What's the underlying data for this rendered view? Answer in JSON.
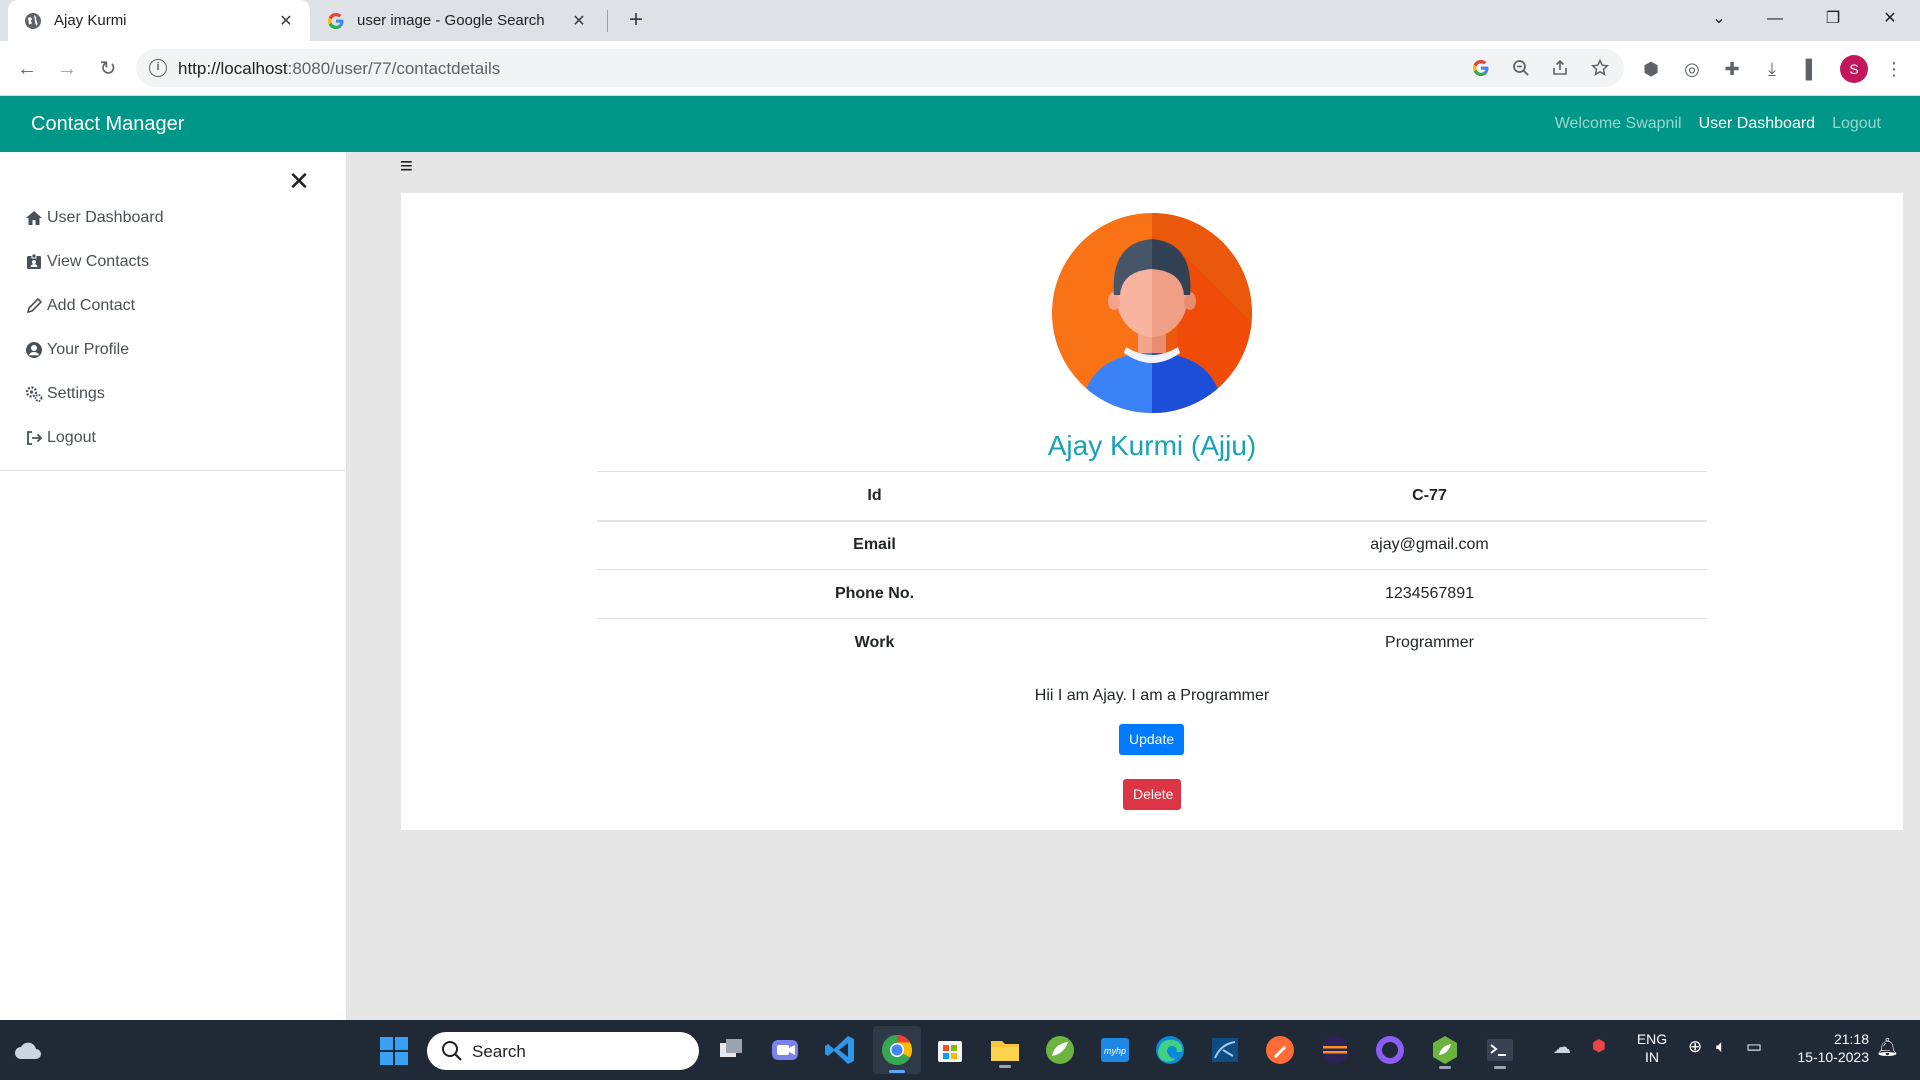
{
  "browser": {
    "tabs": [
      {
        "title": "Ajay Kurmi",
        "active": true
      },
      {
        "title": "user image - Google Search",
        "active": false
      }
    ],
    "url_host": "http://localhost",
    "url_rest": ":8080/user/77/contactdetails",
    "profile_initial": "S"
  },
  "navbar": {
    "brand": "Contact Manager",
    "welcome": "Welcome Swapnil",
    "dashboard": "User Dashboard",
    "logout": "Logout"
  },
  "sidebar": {
    "items": [
      {
        "label": "User Dashboard",
        "icon": "home-icon"
      },
      {
        "label": "View Contacts",
        "icon": "id-card-icon"
      },
      {
        "label": "Add Contact",
        "icon": "pencil-icon"
      },
      {
        "label": "Your Profile",
        "icon": "user-circle-icon"
      },
      {
        "label": "Settings",
        "icon": "cogs-icon"
      },
      {
        "label": "Logout",
        "icon": "sign-out-icon"
      }
    ]
  },
  "contact": {
    "name": "Ajay Kurmi (Ajju)",
    "rows": [
      {
        "key": "Id",
        "value": "C-77"
      },
      {
        "key": "Email",
        "value": "ajay@gmail.com"
      },
      {
        "key": "Phone No.",
        "value": "1234567891"
      },
      {
        "key": "Work",
        "value": "Programmer"
      }
    ],
    "description": "Hii I am Ajay. I am a Programmer",
    "update_label": "Update",
    "delete_label": "Delete"
  },
  "taskbar": {
    "search_label": "Search",
    "lang_top": "ENG",
    "lang_bottom": "IN",
    "time": "21:18",
    "date": "15-10-2023"
  },
  "colors": {
    "navbar": "#009688",
    "name": "#17a2b8",
    "update": "#007bff",
    "delete": "#dc3545"
  }
}
